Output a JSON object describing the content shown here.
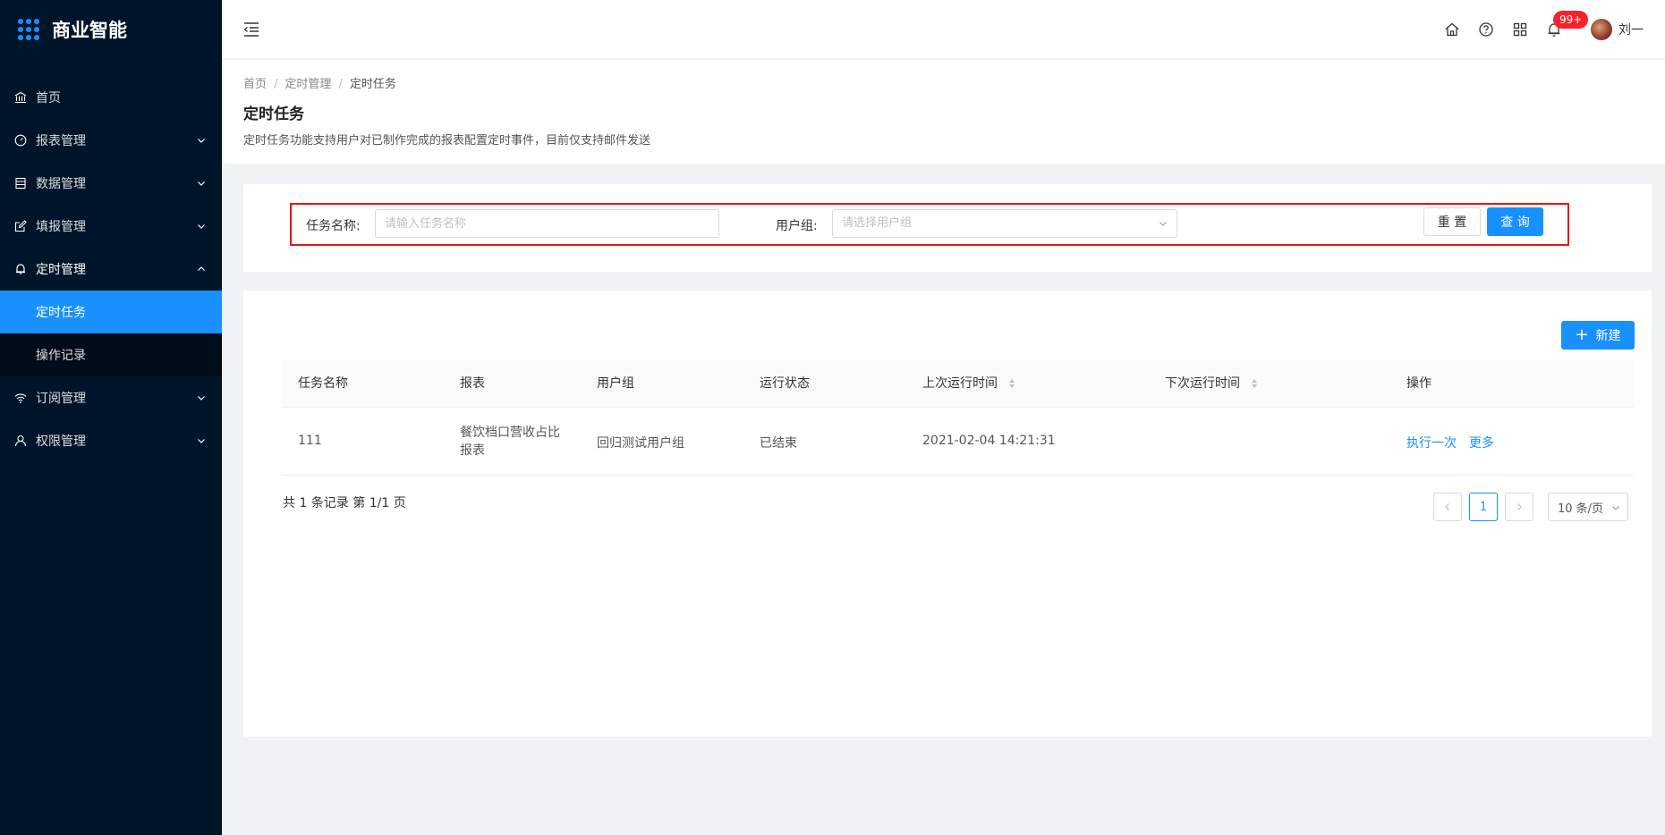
{
  "app": {
    "title": "商业智能"
  },
  "sidebar": {
    "items": [
      {
        "label": "首页"
      },
      {
        "label": "报表管理"
      },
      {
        "label": "数据管理"
      },
      {
        "label": "填报管理"
      },
      {
        "label": "定时管理"
      },
      {
        "label": "订阅管理"
      },
      {
        "label": "权限管理"
      }
    ],
    "sub_items": [
      {
        "label": "定时任务"
      },
      {
        "label": "操作记录"
      }
    ]
  },
  "header": {
    "badge": "99+",
    "username": "刘一"
  },
  "breadcrumb": [
    "首页",
    "定时管理",
    "定时任务"
  ],
  "page": {
    "title": "定时任务",
    "description": "定时任务功能支持用户对已制作完成的报表配置定时事件，目前仅支持邮件发送"
  },
  "search": {
    "task_label": "任务名称:",
    "task_placeholder": "请输入任务名称",
    "group_label": "用户组:",
    "group_placeholder": "请选择用户组",
    "reset_label": "重 置",
    "query_label": "查 询"
  },
  "table": {
    "new_label": "新建",
    "columns": [
      "任务名称",
      "报表",
      "用户组",
      "运行状态",
      "上次运行时间",
      "下次运行时间",
      "操作"
    ],
    "rows": [
      {
        "name": "111",
        "report_line1": "餐饮档口营收占比",
        "report_line2": "报表",
        "group": "回归测试用户组",
        "status": "已结束",
        "last_run": "2021-02-04 14:21:31",
        "next_run": "",
        "action_run": "执行一次",
        "action_more": "更多"
      }
    ]
  },
  "pagination": {
    "summary": "共 1 条记录 第 1/1 页",
    "current_page": "1",
    "page_size": "10 条/页"
  },
  "colors": {
    "primary": "#1890ff",
    "sidebar_bg": "#001529",
    "highlight_border": "#e5141b",
    "badge": "#f5222d"
  }
}
